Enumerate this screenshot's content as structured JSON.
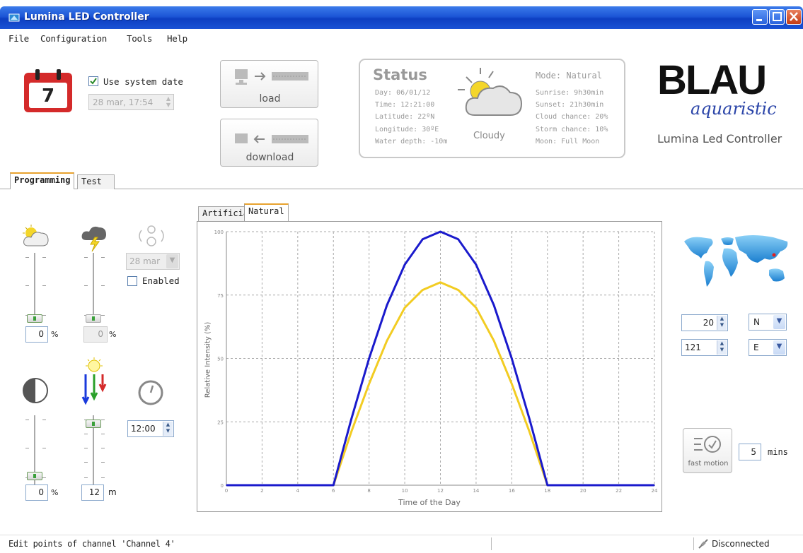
{
  "window": {
    "title": "Lumina LED Controller"
  },
  "menu": [
    "File",
    "Configuration",
    "Tools",
    "Help"
  ],
  "date_panel": {
    "calendar_day": "7",
    "use_system_date_label": "Use system date",
    "use_system_date_checked": true,
    "date_value": "28 mar, 17:54"
  },
  "transfer": {
    "load_label": "load",
    "download_label": "download"
  },
  "status": {
    "title": "Status",
    "day": "Day: 06/01/12",
    "time": "Time: 12:21:00",
    "latitude": "Latitude: 22ºN",
    "longitude": "Longitude: 30ºE",
    "water_depth": "Water depth: -10m",
    "weather": "Cloudy",
    "mode": "Mode: Natural",
    "sunrise": "Sunrise: 9h30min",
    "sunset": "Sunset: 21h30min",
    "cloud_chance": "Cloud chance: 20%",
    "storm_chance": "Storm chance: 10%",
    "moon": "Moon: Full Moon"
  },
  "brand": {
    "logo_text": "BLAU",
    "logo_script": "aquaristic",
    "subtitle": "Lumina Led Controller"
  },
  "main_tabs": [
    "Programming",
    "Test"
  ],
  "programming": {
    "cloud_value": "0",
    "cloud_unit": "%",
    "storm_value": "0",
    "storm_unit": "%",
    "moon_date": "28 mar",
    "enabled_label": "Enabled",
    "enabled_checked": false,
    "moon_phase_value": "0",
    "moon_phase_unit": "%",
    "depth_value": "12",
    "depth_unit": "m",
    "time_value": "12:00"
  },
  "chart_tabs": [
    "Artificial",
    "Natural"
  ],
  "chart_data": {
    "type": "line",
    "xlabel": "Time of the Day",
    "ylabel": "Relative Intensity (%)",
    "xlim": [
      0,
      24
    ],
    "ylim": [
      0,
      100
    ],
    "x_ticks": [
      "0",
      "2",
      "4",
      "6",
      "8",
      "10",
      "12",
      "14",
      "16",
      "18",
      "20",
      "22",
      "24"
    ],
    "y_ticks": [
      "0",
      "25",
      "50",
      "75",
      "100"
    ],
    "grid": true,
    "series": [
      {
        "color": "#1a1acc",
        "x": [
          0,
          6,
          7,
          8,
          9,
          10,
          11,
          12,
          13,
          14,
          15,
          16,
          17,
          18,
          24
        ],
        "values": [
          0,
          0,
          26,
          50,
          71,
          87,
          97,
          100,
          97,
          87,
          71,
          50,
          26,
          0,
          0
        ]
      },
      {
        "color": "#f2cc22",
        "x": [
          0,
          6,
          7,
          8,
          9,
          10,
          11,
          12,
          13,
          14,
          15,
          16,
          17,
          18,
          24
        ],
        "values": [
          0,
          0,
          21,
          40,
          57,
          70,
          77,
          80,
          77,
          70,
          57,
          40,
          21,
          0,
          0
        ]
      }
    ]
  },
  "location": {
    "latitude_value": "20",
    "latitude_dir": "N",
    "longitude_value": "121",
    "longitude_dir": "E"
  },
  "fast_motion": {
    "label": "fast motion",
    "minutes_value": "5",
    "minutes_unit": "mins"
  },
  "statusbar": {
    "message": "Edit points of channel 'Channel 4'",
    "connection": "Disconnected"
  },
  "colors": {
    "title_bar": "#1c55d6",
    "tab_accent": "#e8a22e",
    "calendar_red": "#d42a2a"
  }
}
